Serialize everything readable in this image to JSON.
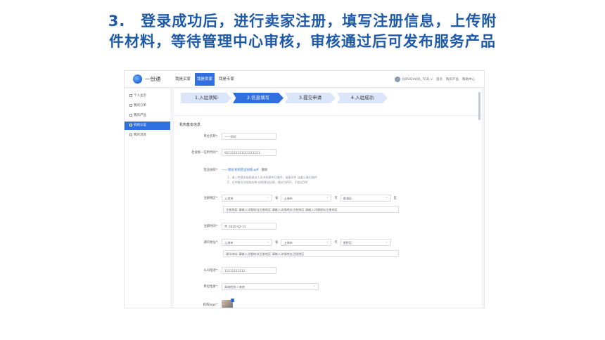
{
  "slide": {
    "title_line1": "3.　登录成功后，进行卖家注册，填写注册信息，上传附",
    "title_line2": "件材料，等待管理中心审核，审核通过后可发布服务产品"
  },
  "app": {
    "logo_text": "一份通",
    "nav_tabs": [
      "我是买家",
      "我是卖家",
      "我是专家"
    ],
    "user_name": "Q05024041_TGO ∨",
    "top_links": [
      "首页",
      "购买产品",
      "帮助中心"
    ]
  },
  "sidebar": {
    "items": [
      "个人主页",
      "我的订单",
      "我的产品",
      "机构认证",
      "我的消息"
    ]
  },
  "steps": [
    "1.入驻须知",
    "2.信息填写",
    "3.提交申请",
    "4.入驻成功"
  ],
  "form": {
    "section_title": "机构基本信息",
    "org_name_label": "单位名称*：",
    "org_name_value": "——测试",
    "credit_code_label": "社会统一信用代码*：",
    "credit_code_value": "9111111111111111111",
    "license_label": "营业执照*：",
    "license_file": "——测试 机构营业执照.pdf",
    "license_delete": "删除",
    "license_hint1": "1、请上传营业执照或法人证书的原件扫描件，或复印件 加盖公章扫描件",
    "license_hint2": "2、文件格式为机构名称-机构营业执照，格式为PDF，不超过5M",
    "reg_area_label": "注册地区*：",
    "reg_province": "上海市",
    "reg_city": "上海市",
    "reg_district": "青浦区",
    "unit_province": "省",
    "unit_city": "市",
    "unit_district": "区",
    "reg_address": "注册地区 请输入详细地址注册地区 请输入详细地址注册地区 请输入详细地址注册地区",
    "reg_date_label": "注册时间*：",
    "reg_date_value": "2020-02-11",
    "mail_area_label": "通讯地址*：",
    "mail_province": "上海市",
    "mail_city": "上海市",
    "mail_district": "普陀区",
    "mail_address": "通讯地址 请输入详细地址注册地区 请输入详细地址注册地区",
    "phone_label": "公司电话*：",
    "phone_value": "11111111111",
    "nature_label": "单位性质*：",
    "nature_value": "高校院所 / 其他",
    "photo_label": "机构logo*："
  }
}
